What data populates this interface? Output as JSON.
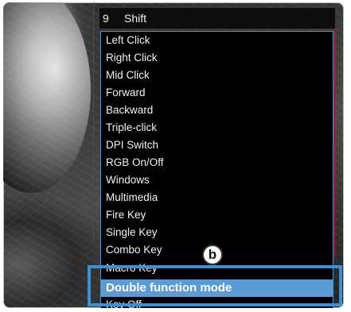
{
  "header": {
    "number": "9",
    "key": "Shift"
  },
  "menu": {
    "items": [
      "Left Click",
      "Right Click",
      "Mid Click",
      "Forward",
      "Backward",
      "Triple-click",
      "DPI Switch",
      "RGB On/Off",
      "Windows",
      "Multimedia",
      "Fire Key",
      "Single Key",
      "Combo Key",
      "Macro Key",
      "Double function mode",
      "Key Off"
    ],
    "highlighted": "Double function mode"
  },
  "callout": {
    "label": "b"
  },
  "colors": {
    "highlight": "#5b9bd5",
    "callout": "#3d8fcf",
    "accent_red": "#c21a1a"
  }
}
